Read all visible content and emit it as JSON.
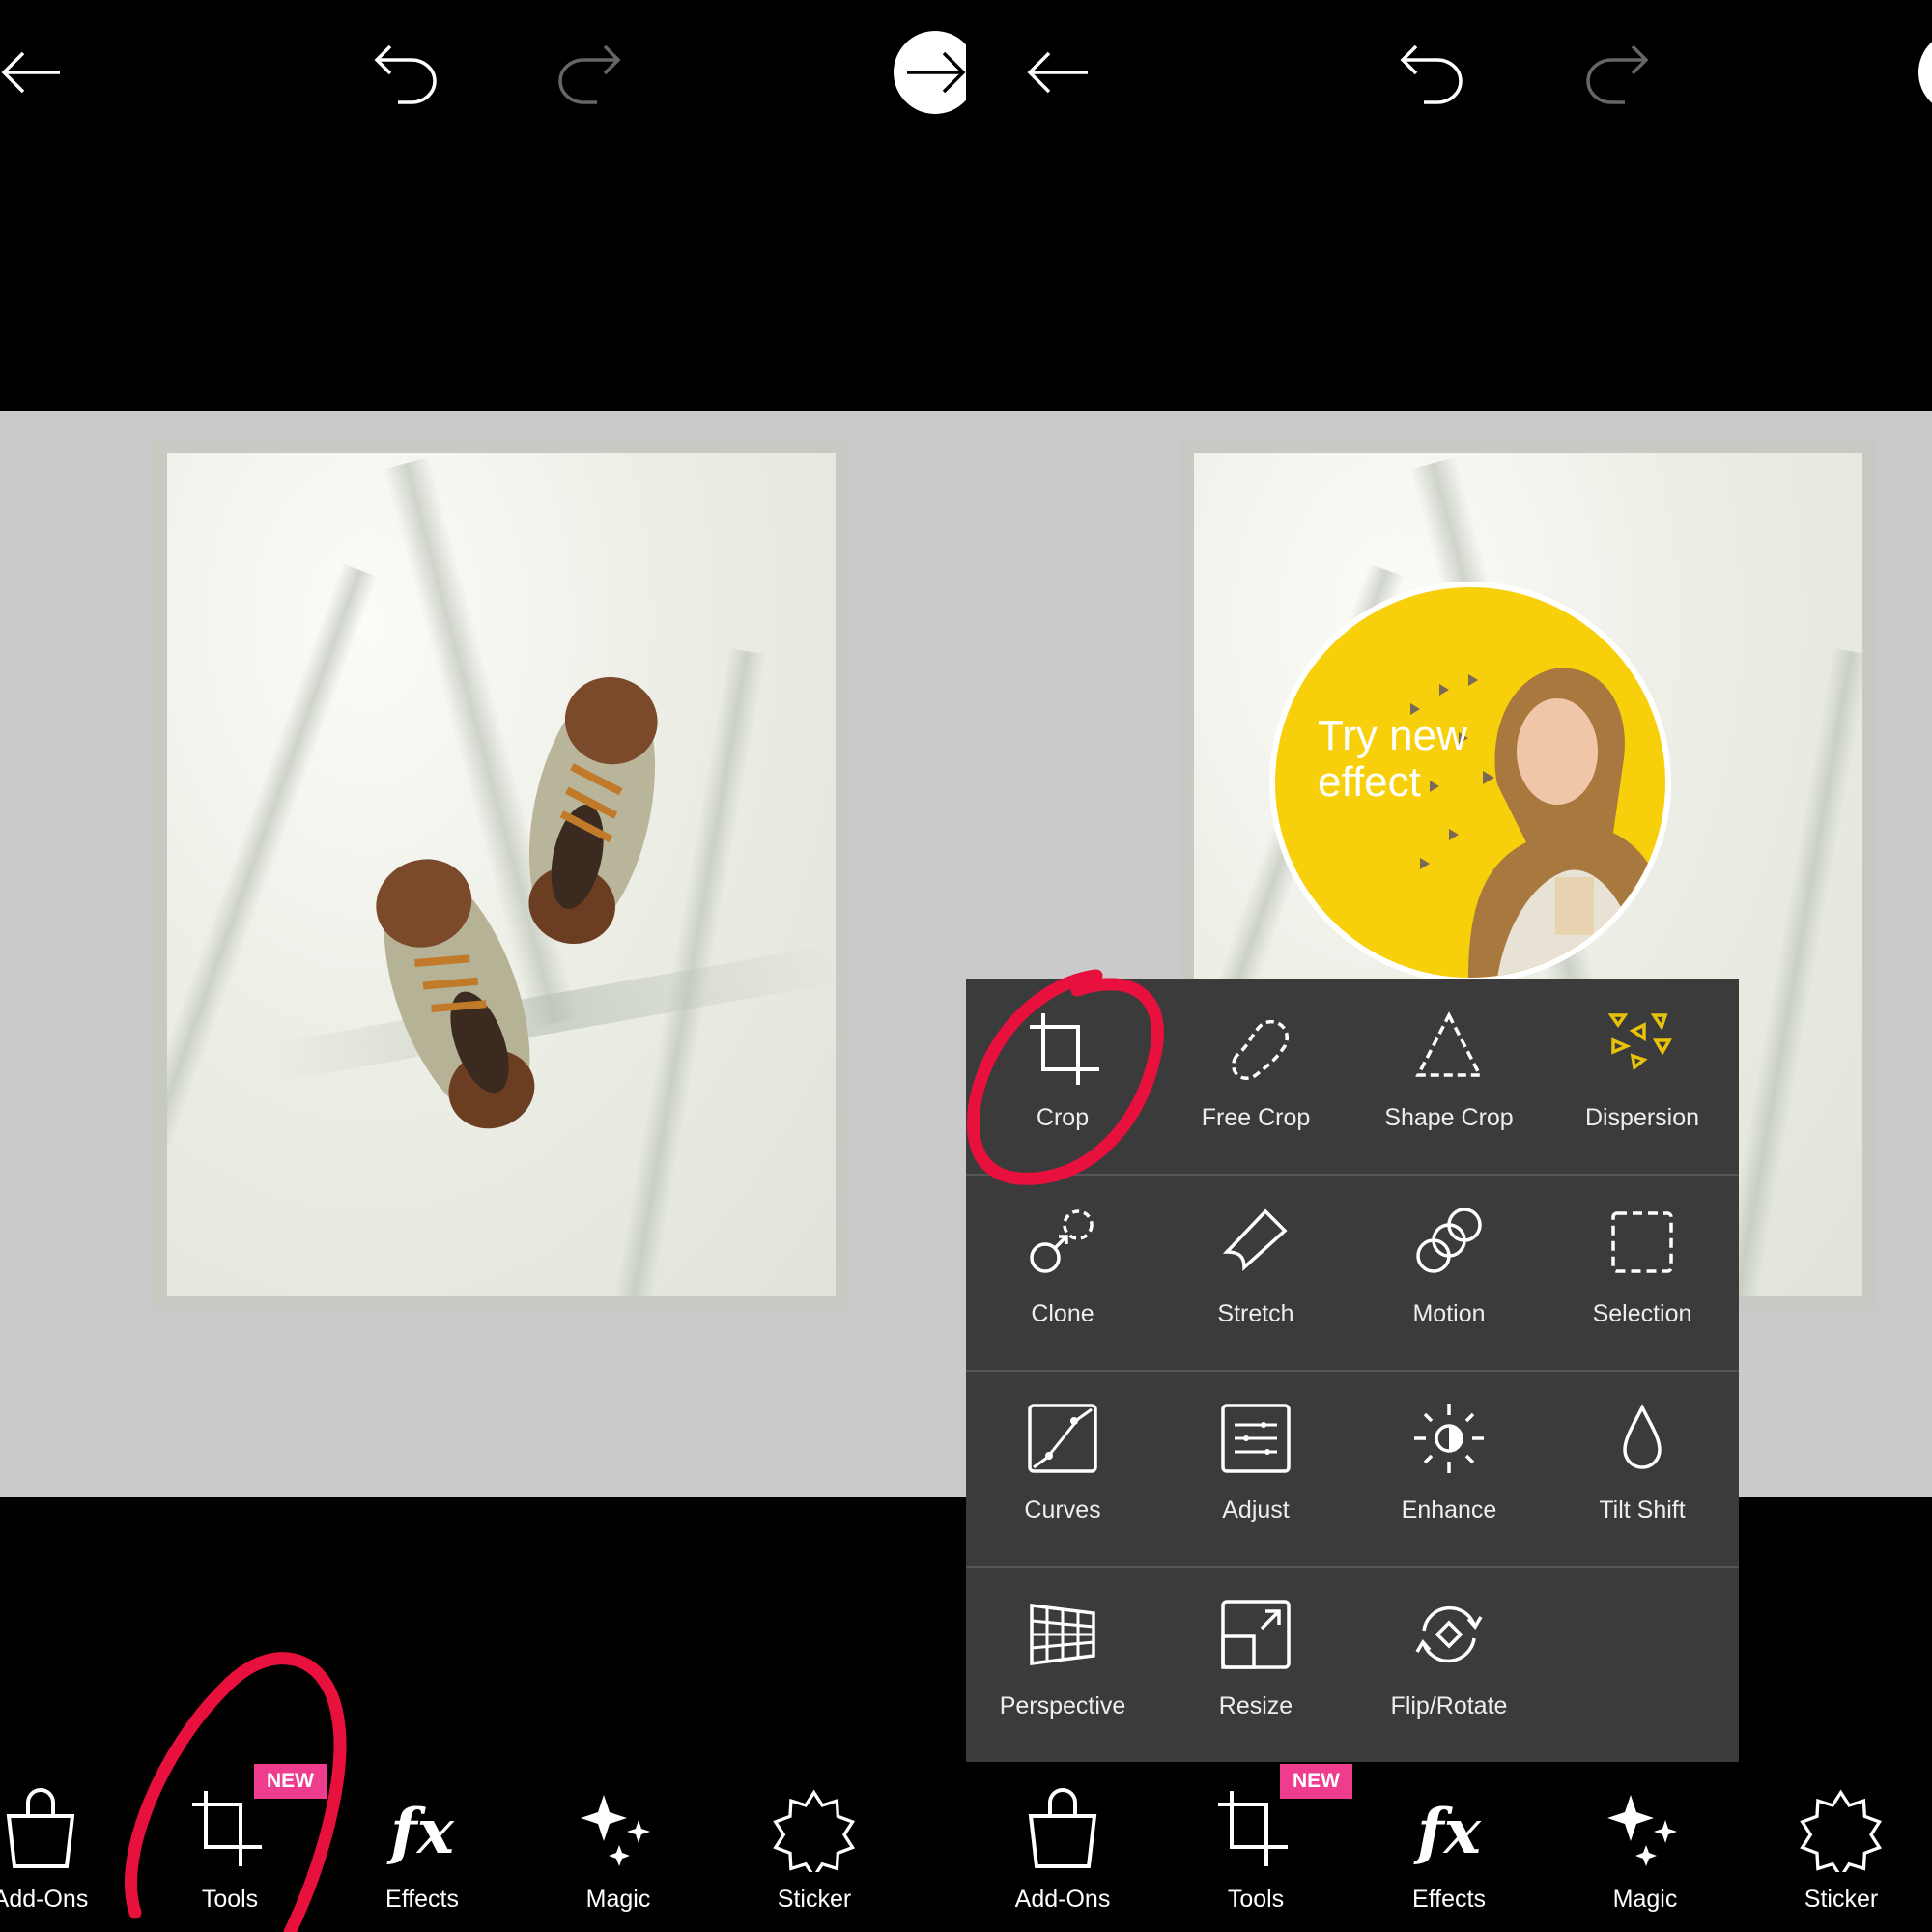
{
  "panels": [
    {
      "top_icons": [
        "back-arrow-icon",
        "undo-icon",
        "redo-icon",
        "next-arrow-icon"
      ]
    },
    {
      "top_icons": [
        "back-arrow-icon",
        "undo-icon",
        "redo-icon",
        "next-arrow-icon"
      ],
      "promo": {
        "text_line1": "Try new",
        "text_line2": "effect",
        "color": "#f7cf0a"
      }
    }
  ],
  "bottom_nav": [
    {
      "label": "Add-Ons",
      "icon": "shopping-bag-icon"
    },
    {
      "label": "Tools",
      "icon": "crop-icon",
      "badge": "NEW"
    },
    {
      "label": "Effects",
      "icon": "fx-icon"
    },
    {
      "label": "Magic",
      "icon": "sparkles-icon"
    },
    {
      "label": "Sticker",
      "icon": "sticker-icon"
    }
  ],
  "tools_menu": [
    {
      "label": "Crop",
      "icon": "crop-icon"
    },
    {
      "label": "Free Crop",
      "icon": "free-crop-icon"
    },
    {
      "label": "Shape Crop",
      "icon": "shape-crop-icon"
    },
    {
      "label": "Dispersion",
      "icon": "dispersion-icon"
    },
    {
      "label": "Clone",
      "icon": "clone-icon"
    },
    {
      "label": "Stretch",
      "icon": "stretch-icon"
    },
    {
      "label": "Motion",
      "icon": "motion-icon"
    },
    {
      "label": "Selection",
      "icon": "selection-icon"
    },
    {
      "label": "Curves",
      "icon": "curves-icon"
    },
    {
      "label": "Adjust",
      "icon": "adjust-icon"
    },
    {
      "label": "Enhance",
      "icon": "enhance-icon"
    },
    {
      "label": "Tilt Shift",
      "icon": "tilt-shift-icon"
    },
    {
      "label": "Perspective",
      "icon": "perspective-icon"
    },
    {
      "label": "Resize",
      "icon": "resize-icon"
    },
    {
      "label": "Flip/Rotate",
      "icon": "flip-rotate-icon"
    }
  ],
  "colors": {
    "badge": "#ee3d8f",
    "menu_bg": "#3b3b3b",
    "annotation": "#e8103c",
    "dispersion_accent": "#e8c20a"
  }
}
